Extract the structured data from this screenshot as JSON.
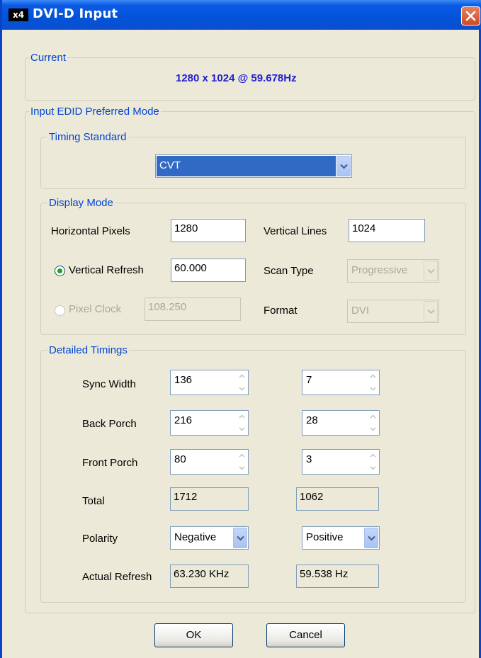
{
  "window": {
    "icon_text": "x4",
    "title": "DVI-D Input"
  },
  "current": {
    "group_label": "Current",
    "value": "1280 x 1024 @ 59.678Hz"
  },
  "preferred_mode": {
    "group_label": "Input EDID Preferred Mode",
    "timing_standard": {
      "group_label": "Timing Standard",
      "selected": "CVT"
    },
    "display_mode": {
      "group_label": "Display Mode",
      "horizontal_pixels_label": "Horizontal Pixels",
      "horizontal_pixels": "1280",
      "vertical_lines_label": "Vertical Lines",
      "vertical_lines": "1024",
      "vertical_refresh_label": "Vertical Refresh",
      "vertical_refresh": "60.000",
      "vertical_refresh_selected": true,
      "scan_type_label": "Scan Type",
      "scan_type": "Progressive",
      "pixel_clock_label": "Pixel Clock",
      "pixel_clock": "108.250",
      "pixel_clock_selected": false,
      "format_label": "Format",
      "format": "DVI"
    },
    "detailed_timings": {
      "group_label": "Detailed Timings",
      "sync_width_label": "Sync Width",
      "sync_width_h": "136",
      "sync_width_v": "7",
      "back_porch_label": "Back Porch",
      "back_porch_h": "216",
      "back_porch_v": "28",
      "front_porch_label": "Front Porch",
      "front_porch_h": "80",
      "front_porch_v": "3",
      "total_label": "Total",
      "total_h": "1712",
      "total_v": "1062",
      "polarity_label": "Polarity",
      "polarity_h": "Negative",
      "polarity_v": "Positive",
      "actual_refresh_label": "Actual Refresh",
      "actual_refresh_h": "63.230 KHz",
      "actual_refresh_v": "59.538 Hz"
    }
  },
  "buttons": {
    "ok": "OK",
    "cancel": "Cancel"
  },
  "colors": {
    "title_bar": "#0353d8",
    "group_label": "#0046d5",
    "current_value": "#1f1fd0",
    "selection": "#316ac5"
  }
}
